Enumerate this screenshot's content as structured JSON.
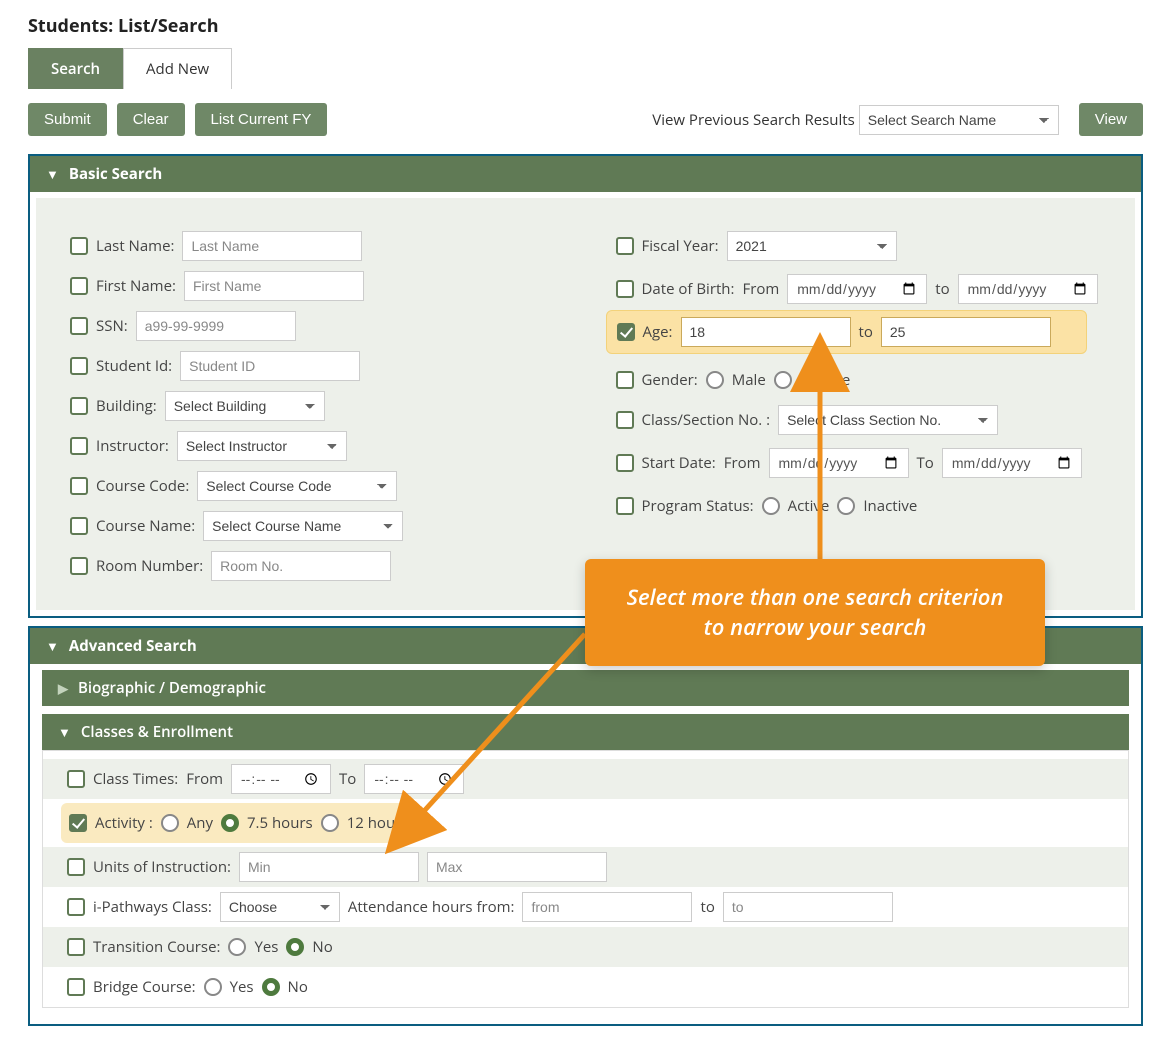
{
  "page_title": "Students: List/Search",
  "tabs": {
    "search": "Search",
    "add_new": "Add New"
  },
  "toolbar": {
    "submit": "Submit",
    "clear": "Clear",
    "list_current_fy": "List Current FY",
    "view_previous_label": "View Previous Search Results",
    "select_search_name": "Select Search Name",
    "view": "View"
  },
  "panels": {
    "basic": "Basic Search",
    "advanced": "Advanced Search",
    "bio_demo": "Biographic / Demographic",
    "classes": "Classes & Enrollment"
  },
  "basic": {
    "last_name": {
      "label": "Last Name:",
      "placeholder": "Last Name"
    },
    "first_name": {
      "label": "First Name:",
      "placeholder": "First Name"
    },
    "ssn": {
      "label": "SSN:",
      "placeholder": "a99-99-9999"
    },
    "student_id": {
      "label": "Student Id:",
      "placeholder": "Student ID"
    },
    "building": {
      "label": "Building:",
      "placeholder": "Select Building"
    },
    "instructor": {
      "label": "Instructor:",
      "placeholder": "Select Instructor"
    },
    "course_code": {
      "label": "Course Code:",
      "placeholder": "Select Course Code"
    },
    "course_name": {
      "label": "Course Name:",
      "placeholder": "Select Course Name"
    },
    "room_number": {
      "label": "Room Number:",
      "placeholder": "Room No."
    },
    "fiscal_year": {
      "label": "Fiscal Year:",
      "value": "2021"
    },
    "dob": {
      "label": "Date of Birth:",
      "from": "From",
      "to": "to",
      "placeholder": "mm/dd/yyyy"
    },
    "age": {
      "label": "Age:",
      "from": "18",
      "to_lbl": "to",
      "to": "25"
    },
    "gender": {
      "label": "Gender:",
      "male": "Male",
      "female": "Female"
    },
    "class_section": {
      "label": "Class/Section No. :",
      "placeholder": "Select Class Section No."
    },
    "start_date": {
      "label": "Start Date:",
      "from": "From",
      "to_lbl": "To",
      "placeholder": "mm/dd/yyyy"
    },
    "program_status": {
      "label": "Program Status:",
      "active": "Active",
      "inactive": "Inactive"
    }
  },
  "classes": {
    "class_times": {
      "label": "Class Times:",
      "from": "From",
      "to": "To",
      "placeholder": "--:-- --"
    },
    "activity": {
      "label": "Activity :",
      "any": "Any",
      "hrs75": "7.5 hours",
      "hrs12": "12 hours"
    },
    "units": {
      "label": "Units of Instruction:",
      "min": "Min",
      "max": "Max"
    },
    "ipathways": {
      "label": "i-Pathways Class:",
      "choose": "Choose",
      "att_from": "Attendance hours from:",
      "from_ph": "from",
      "to_lbl": "to",
      "to_ph": "to"
    },
    "transition": {
      "label": "Transition Course:",
      "yes": "Yes",
      "no": "No"
    },
    "bridge": {
      "label": "Bridge Course:",
      "yes": "Yes",
      "no": "No"
    }
  },
  "callout": "Select more than one search criterion to narrow your search"
}
